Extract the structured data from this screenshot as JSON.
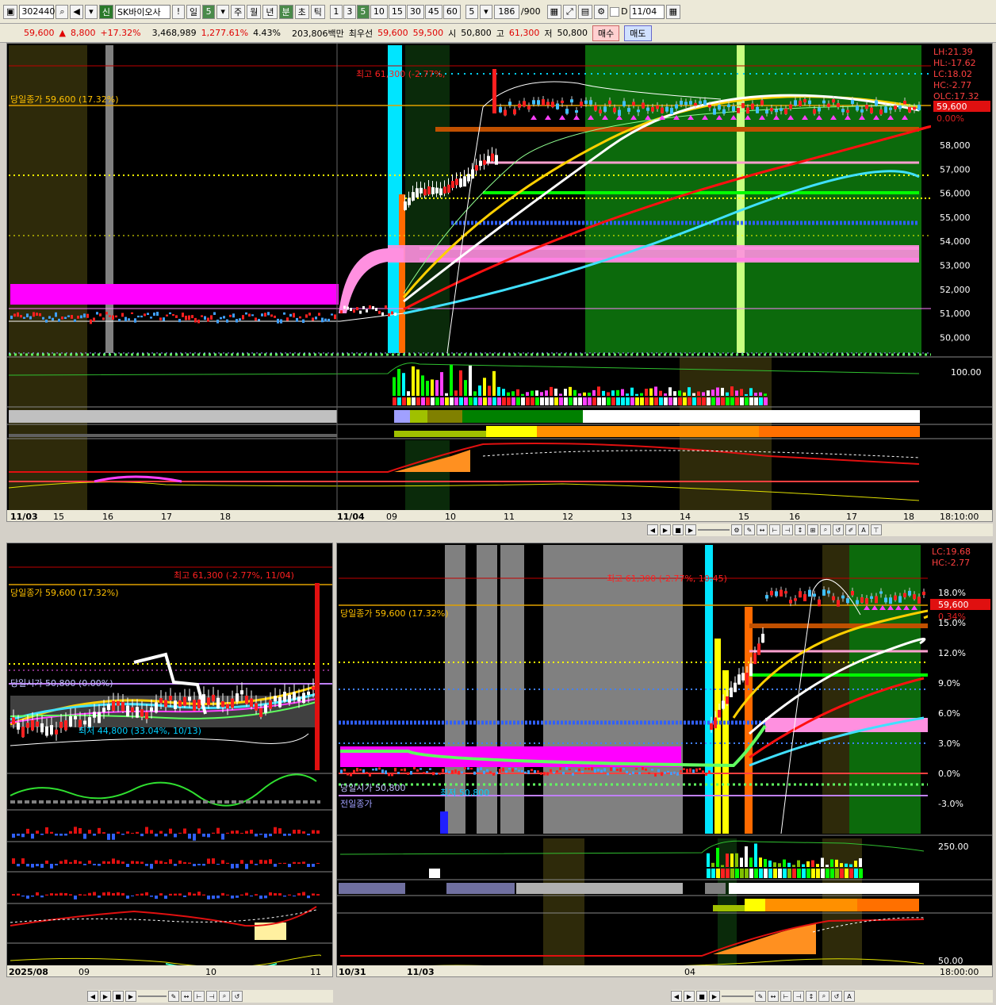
{
  "toolbar": {
    "code": "302440",
    "badge": "신",
    "name": "SK바이오사",
    "warn": "!",
    "period_day": "일",
    "period_num": "5",
    "week": "주",
    "month": "월",
    "year": "년",
    "minute": "분",
    "second": "초",
    "tick": "틱",
    "intervals": [
      "1",
      "3",
      "5",
      "10",
      "15",
      "30",
      "45",
      "60"
    ],
    "active_interval": "5",
    "interval_field": "5",
    "count": "186",
    "count_total": "/900",
    "date": "11/04",
    "d_label": "D"
  },
  "quote": {
    "price": "59,600",
    "arrow": "▲",
    "change": "8,800",
    "change_pct": "+17.32%",
    "volume": "3,468,989",
    "vol_pct": "1,277.61%",
    "turnover": "4.43%",
    "amount": "203,806백만",
    "best_label": "최우선",
    "ask": "59,600",
    "bid": "59,500",
    "open_label": "시",
    "open": "50,800",
    "high_label": "고",
    "high": "61,300",
    "low_label": "저",
    "low": "50,800",
    "buy": "매수",
    "sell": "매도"
  },
  "top_chart": {
    "close_label": "당일종가 59,600 (17.32%)",
    "high_label": "최고 61,300 (-2.77%,",
    "right_labels": [
      "LH:21.39",
      "HL:-17.62",
      "LC:18.02",
      "HC:-2.77",
      "OLC:17.32"
    ],
    "price_tag": "59,600",
    "pct_tag": "0.00%",
    "price_axis": [
      "58,000",
      "57,000",
      "56,000",
      "55,000",
      "54,000",
      "53,000",
      "52,000",
      "51,000",
      "50,000"
    ],
    "ind_axis": "100.00",
    "x_labels": [
      "11/03",
      "15",
      "16",
      "17",
      "18",
      "11/04",
      "09",
      "10",
      "11",
      "12",
      "13",
      "14",
      "15",
      "16",
      "17",
      "18"
    ],
    "time": "18:10:00"
  },
  "bottom_left": {
    "high_label": "최고 61,300 (-2.77%, 11/04)",
    "close_label": "당일종가 59,600 (17.32%)",
    "open_label": "당일시가 50,800 (0.00%)",
    "low_label": "최저 44,800 (33.04%, 10/13)",
    "x_labels": [
      "2025/08",
      "09",
      "10",
      "11"
    ]
  },
  "bottom_right": {
    "high_label": "최고 61,300 (-2.77%, 10:45)",
    "close_label": "당일종가 59,600 (17.32%)",
    "open_label": "당일시가 50,800",
    "low_label": "최저 50,800",
    "prev_label": "전일종가",
    "right_labels": [
      "LC:19.68",
      "HC:-2.77"
    ],
    "price_tag": "59,600",
    "pct_tag": "0.34%",
    "pct_axis": [
      "18.0%",
      "15.0%",
      "12.0%",
      "9.0%",
      "6.0%",
      "3.0%",
      "0.0%",
      "-3.0%"
    ],
    "ind_axis_1": "250.00",
    "ind_axis_2": "50.00",
    "x_labels": [
      "10/31",
      "11/03",
      "04"
    ],
    "time": "18:00:00"
  }
}
